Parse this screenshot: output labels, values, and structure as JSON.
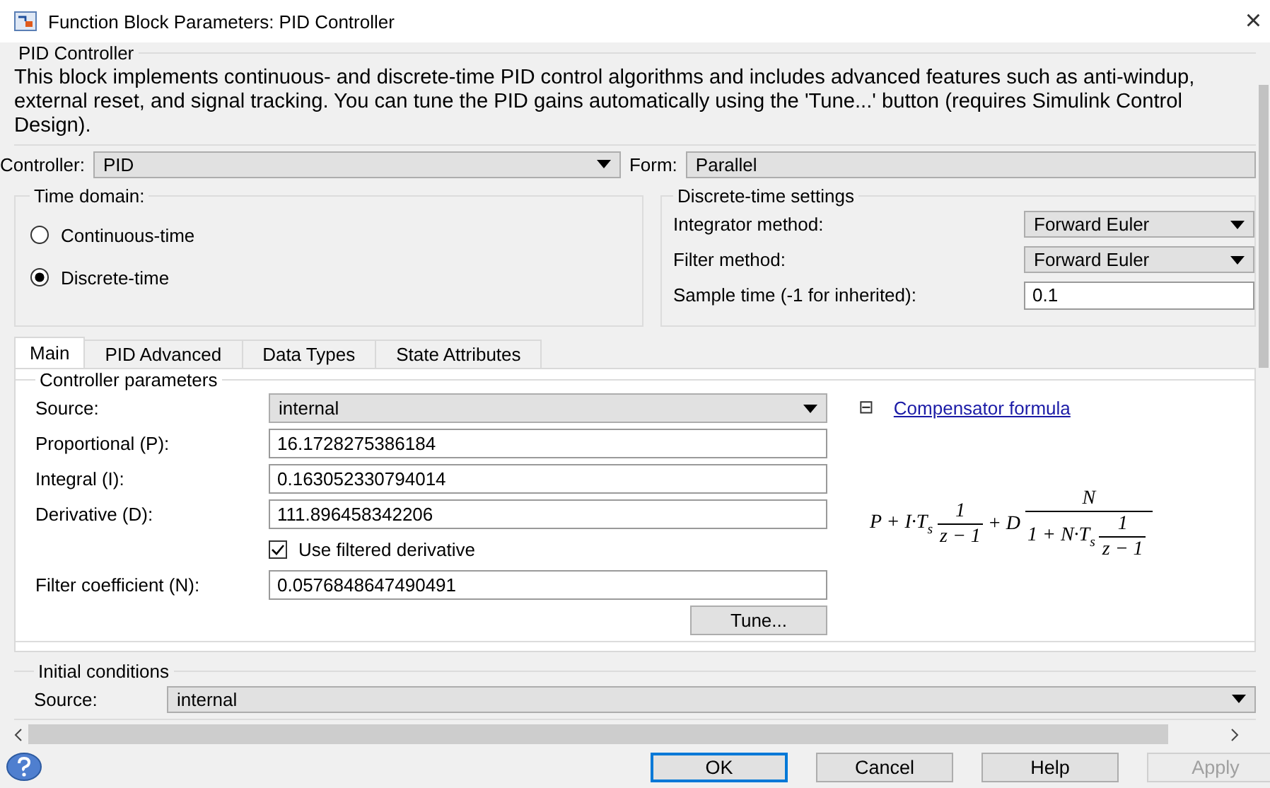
{
  "window": {
    "title": "Function Block Parameters: PID Controller",
    "close": "×"
  },
  "block": {
    "title": "PID Controller",
    "description": "This block implements continuous- and discrete-time PID control algorithms and includes advanced features such as anti-windup, external reset, and signal tracking. You can tune the PID gains automatically using the 'Tune...' button (requires Simulink Control Design)."
  },
  "controller": {
    "label": "Controller:",
    "value": "PID"
  },
  "form": {
    "label": "Form:",
    "value": "Parallel"
  },
  "time_domain": {
    "title": "Time domain:",
    "options": [
      {
        "label": "Continuous-time",
        "selected": false
      },
      {
        "label": "Discrete-time",
        "selected": true
      }
    ]
  },
  "discrete_settings": {
    "title": "Discrete-time settings",
    "fields": [
      {
        "kind": "dropdown",
        "label": "Integrator method:",
        "value": "Forward Euler"
      },
      {
        "kind": "dropdown",
        "label": "Filter method:",
        "value": "Forward Euler"
      },
      {
        "kind": "input",
        "label": "Sample time (-1 for inherited):",
        "value": "0.1"
      }
    ]
  },
  "tabs": [
    {
      "label": "Main",
      "selected": true
    },
    {
      "label": "PID Advanced",
      "selected": false
    },
    {
      "label": "Data Types",
      "selected": false
    },
    {
      "label": "State Attributes",
      "selected": false
    }
  ],
  "controller_parameters": {
    "title": "Controller parameters",
    "fields": [
      {
        "kind": "dropdown",
        "label": "Source:",
        "value": "internal"
      },
      {
        "kind": "input",
        "label": "Proportional (P):",
        "value": "16.1728275386184"
      },
      {
        "kind": "input",
        "label": "Integral (I):",
        "value": "0.163052330794014"
      },
      {
        "kind": "input",
        "label": "Derivative (D):",
        "value": "111.896458342206"
      },
      {
        "kind": "checkbox",
        "label": "Use filtered derivative",
        "checked": true
      },
      {
        "kind": "input",
        "label": "Filter coefficient (N):",
        "value": "0.0576848647490491"
      }
    ],
    "tune_button": "Tune...",
    "formula_toggle": "⊟",
    "formula_link": "Compensator formula",
    "formula": [
      {
        "kind": "text",
        "text": "P + I·T$_{s}$"
      },
      {
        "kind": "frac",
        "num": [
          {
            "kind": "text",
            "text": "1"
          }
        ],
        "den": [
          {
            "kind": "text",
            "text": "z − 1"
          }
        ]
      },
      {
        "kind": "text",
        "text": "+ D"
      },
      {
        "kind": "frac",
        "num": [
          {
            "kind": "text",
            "text": "N"
          }
        ],
        "den": [
          {
            "kind": "text",
            "text": "1 + N·T$_{s}$"
          },
          {
            "kind": "frac",
            "num": [
              {
                "kind": "text",
                "text": "1"
              }
            ],
            "den": [
              {
                "kind": "text",
                "text": "z − 1"
              }
            ]
          }
        ]
      }
    ]
  },
  "initial_conditions": {
    "title": "Initial conditions",
    "source": {
      "label": "Source:",
      "value": "internal"
    }
  },
  "buttons": [
    {
      "label": "OK",
      "default": true,
      "disabled": false
    },
    {
      "label": "Cancel",
      "default": false,
      "disabled": false
    },
    {
      "label": "Help",
      "default": false,
      "disabled": false
    },
    {
      "label": "Apply",
      "default": false,
      "disabled": true
    }
  ]
}
